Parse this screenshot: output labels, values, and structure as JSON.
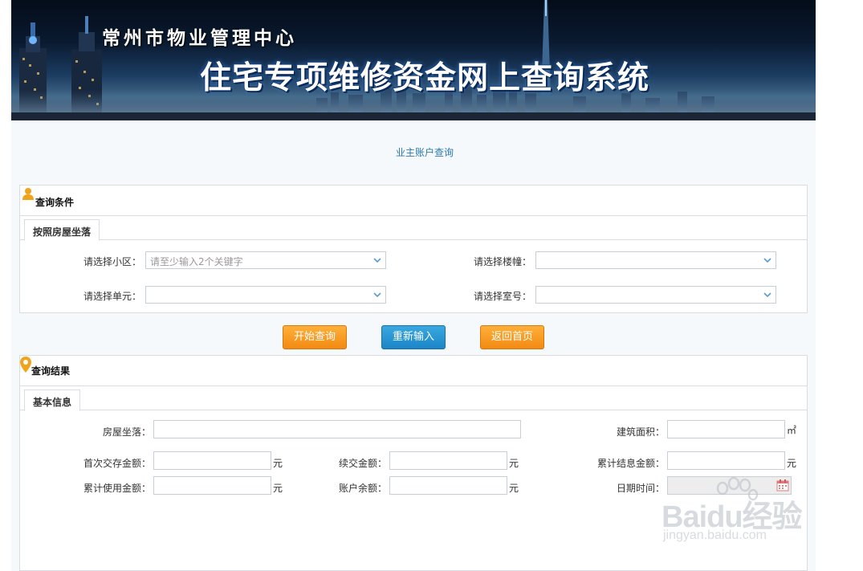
{
  "banner": {
    "org_name": "常州市物业管理中心",
    "system_name": "住宅专项维修资金网上查询系统"
  },
  "page_title": "业主账户查询",
  "query": {
    "header": "查询条件",
    "tab": "按照房屋坐落",
    "fields": {
      "community_label": "请选择小区：",
      "community_placeholder": "请至少输入2个关键字",
      "building_label": "请选择楼幢：",
      "unit_label": "请选择单元：",
      "room_label": "请选择室号："
    }
  },
  "buttons": {
    "start": "开始查询",
    "reset": "重新输入",
    "home": "返回首页"
  },
  "result": {
    "header": "查询结果",
    "tab": "基本信息",
    "fields": {
      "location_label": "房屋坐落：",
      "area_label": "建筑面积：",
      "area_unit": "㎡",
      "first_deposit_label": "首次交存金额：",
      "continued_label": "续交金额：",
      "interest_label": "累计结息金额：",
      "used_label": "累计使用金额：",
      "balance_label": "账户余额：",
      "datetime_label": "日期时间：",
      "currency_unit": "元"
    }
  },
  "watermark": {
    "brand": "Baidu经验",
    "url": "jingyan.baidu.com"
  },
  "colors": {
    "accent_orange": "#f28a12",
    "accent_blue": "#1b85c6",
    "title_blue": "#2a7ab0"
  }
}
